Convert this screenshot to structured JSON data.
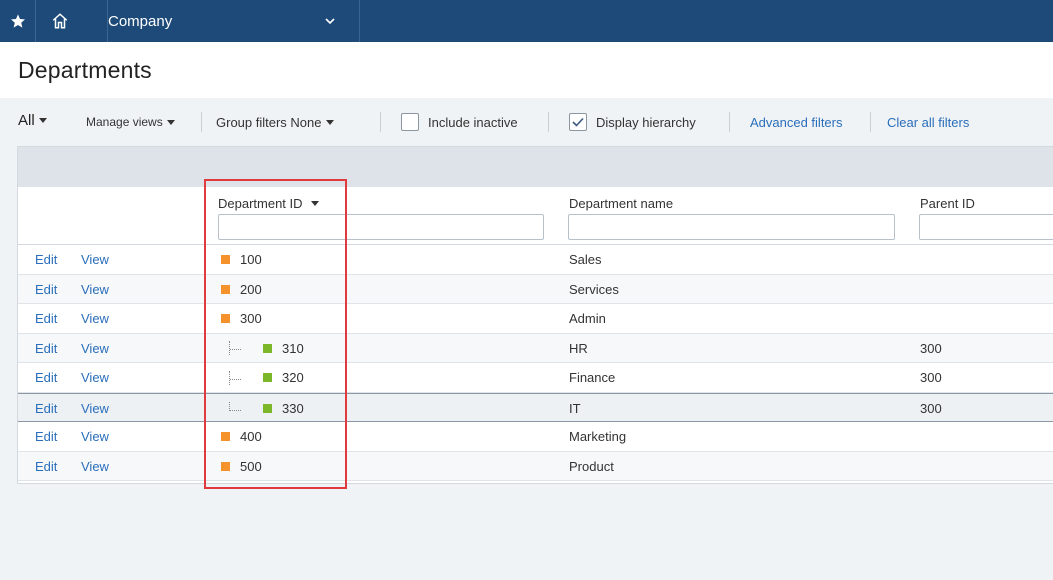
{
  "topbar": {
    "star_icon": "star-icon",
    "home_icon": "home-icon",
    "company_label": "Company"
  },
  "page": {
    "title": "Departments"
  },
  "filters": {
    "view_label": "All",
    "manage_views": "Manage views",
    "group_filters": "Group filters None",
    "include_inactive": {
      "label": "Include inactive",
      "checked": false
    },
    "display_hierarchy": {
      "label": "Display hierarchy",
      "checked": true
    },
    "advanced_filters": "Advanced filters",
    "clear_all_filters": "Clear all filters"
  },
  "table": {
    "columns": {
      "department_id": "Department ID",
      "department_name": "Department name",
      "parent_id": "Parent ID"
    },
    "edit_label": "Edit",
    "view_label": "View",
    "rows": [
      {
        "id": "100",
        "name": "Sales",
        "parent": "",
        "level": 0
      },
      {
        "id": "200",
        "name": "Services",
        "parent": "",
        "level": 0
      },
      {
        "id": "300",
        "name": "Admin",
        "parent": "",
        "level": 0
      },
      {
        "id": "310",
        "name": "HR",
        "parent": "300",
        "level": 1
      },
      {
        "id": "320",
        "name": "Finance",
        "parent": "300",
        "level": 1
      },
      {
        "id": "330",
        "name": "IT",
        "parent": "300",
        "level": 1
      },
      {
        "id": "400",
        "name": "Marketing",
        "parent": "",
        "level": 0
      },
      {
        "id": "500",
        "name": "Product",
        "parent": "",
        "level": 0
      }
    ]
  },
  "colors": {
    "topbar": "#1d4a78",
    "link": "#2a6ebb",
    "parent_marker": "#f5922b",
    "child_marker": "#7bb729",
    "highlight": "#e0393e"
  }
}
